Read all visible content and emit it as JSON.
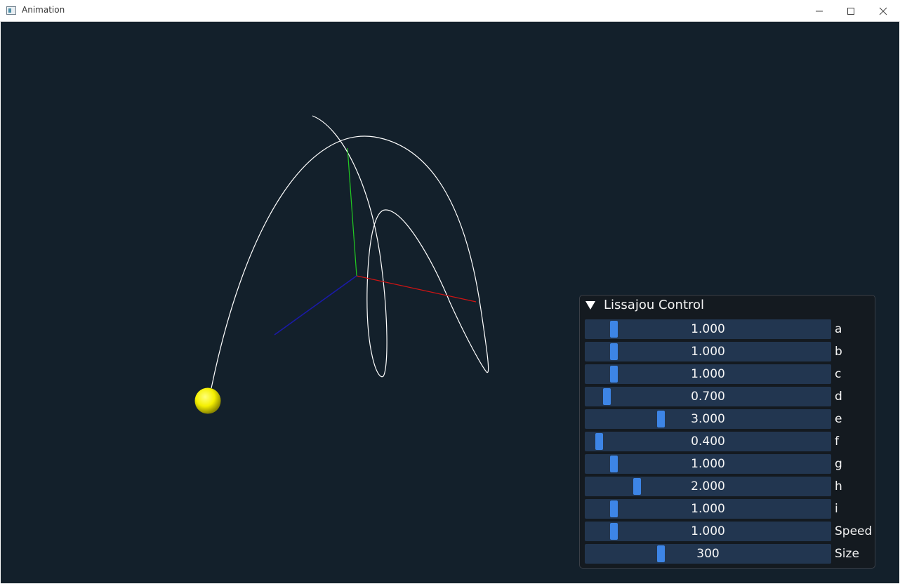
{
  "window": {
    "title": "Animation",
    "controls": [
      "minimize-icon",
      "maximize-icon",
      "close-icon"
    ]
  },
  "scene": {
    "background": "#13202b",
    "axis_colors": {
      "x": "#d01414",
      "y": "#22cc22",
      "z": "#1a1aa8"
    },
    "curve_color": "#ffffff",
    "ball_color": "#f5f000"
  },
  "panel": {
    "title": "Lissajou Control",
    "sliders": [
      {
        "label": "a",
        "value": "1.000",
        "level": 0.1
      },
      {
        "label": "b",
        "value": "1.000",
        "level": 0.1
      },
      {
        "label": "c",
        "value": "1.000",
        "level": 0.1
      },
      {
        "label": "d",
        "value": "0.700",
        "level": 0.07
      },
      {
        "label": "e",
        "value": "3.000",
        "level": 0.3
      },
      {
        "label": "f",
        "value": "0.400",
        "level": 0.04
      },
      {
        "label": "g",
        "value": "1.000",
        "level": 0.1
      },
      {
        "label": "h",
        "value": "2.000",
        "level": 0.2
      },
      {
        "label": "i",
        "value": "1.000",
        "level": 0.1
      },
      {
        "label": "Speed",
        "value": "1.000",
        "level": 0.1
      },
      {
        "label": "Size",
        "value": "300",
        "level": 0.3
      }
    ]
  }
}
